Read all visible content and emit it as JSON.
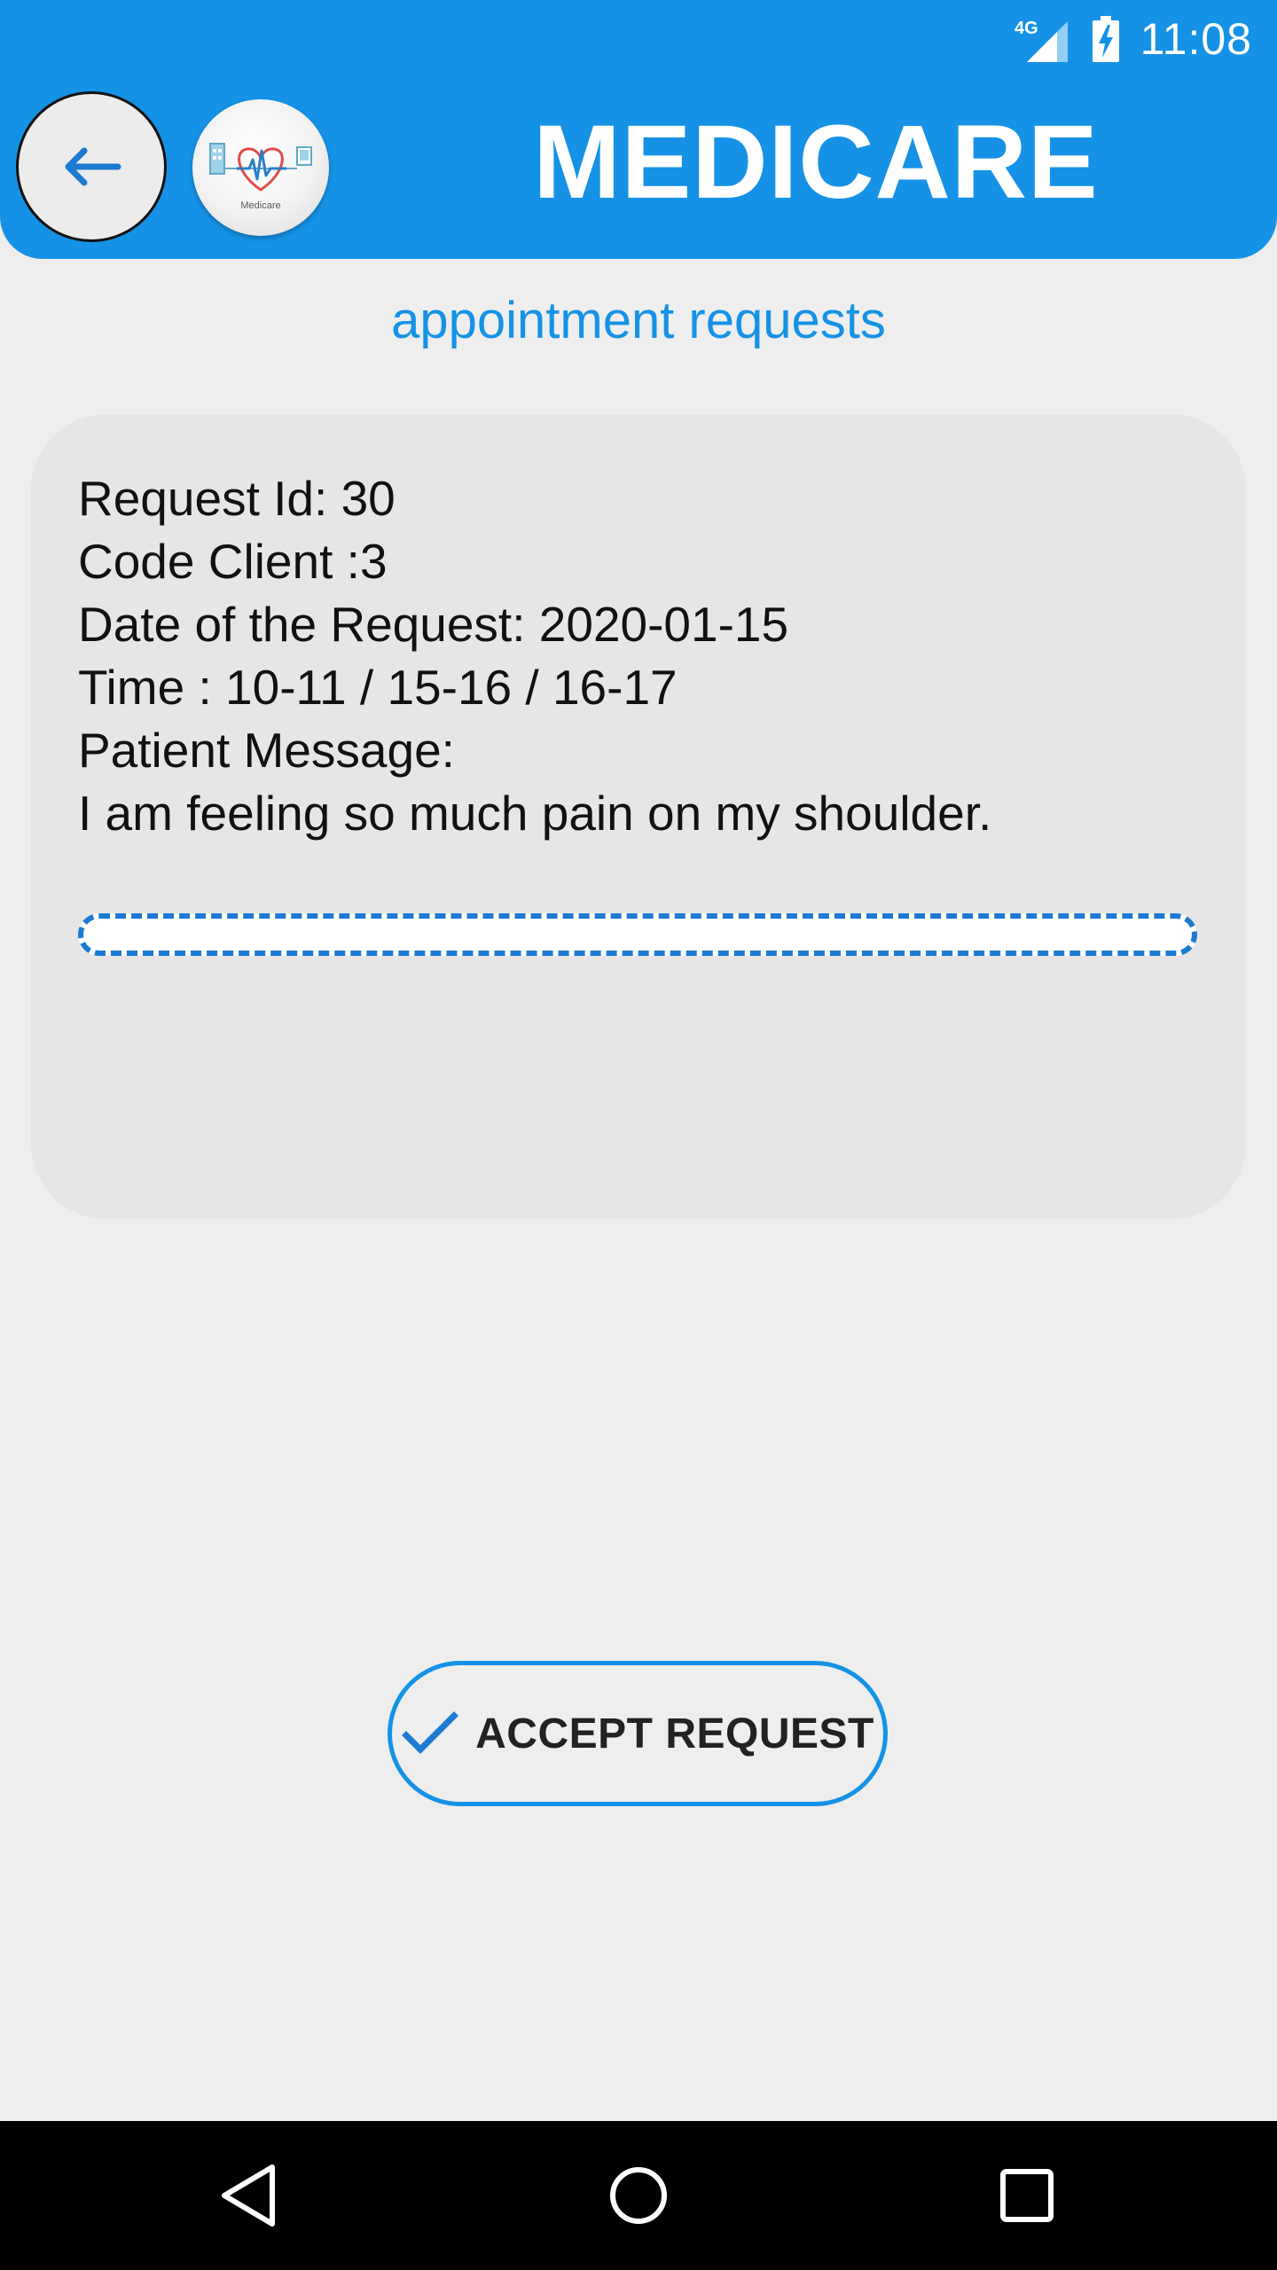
{
  "status_bar": {
    "network": "4G",
    "time": "11:08",
    "icons": [
      "signal-icon",
      "battery-charging-icon"
    ]
  },
  "header": {
    "title": "MEDICARE",
    "logo_caption": "Medicare",
    "back_icon": "arrow-left-icon",
    "color": "#1592e6"
  },
  "page": {
    "subtitle": "appointment requests"
  },
  "request": {
    "id_line": "Request Id: 30",
    "client_line": "Code Client :3",
    "date_line": "Date of the Request: 2020-01-15",
    "time_line": "Time : 10-11 / 15-16 / 16-17",
    "message_label": "Patient Message:",
    "message": "I am feeling so much pain on my shoulder.",
    "response_value": ""
  },
  "actions": {
    "accept_label": "ACCEPT REQUEST",
    "accept_icon": "check-icon"
  },
  "nav": {
    "icons": [
      "back-triangle-icon",
      "home-circle-icon",
      "recents-square-icon"
    ]
  },
  "colors": {
    "accent": "#1592e6",
    "background": "#eeeeee",
    "card": "#e6e6e6"
  }
}
